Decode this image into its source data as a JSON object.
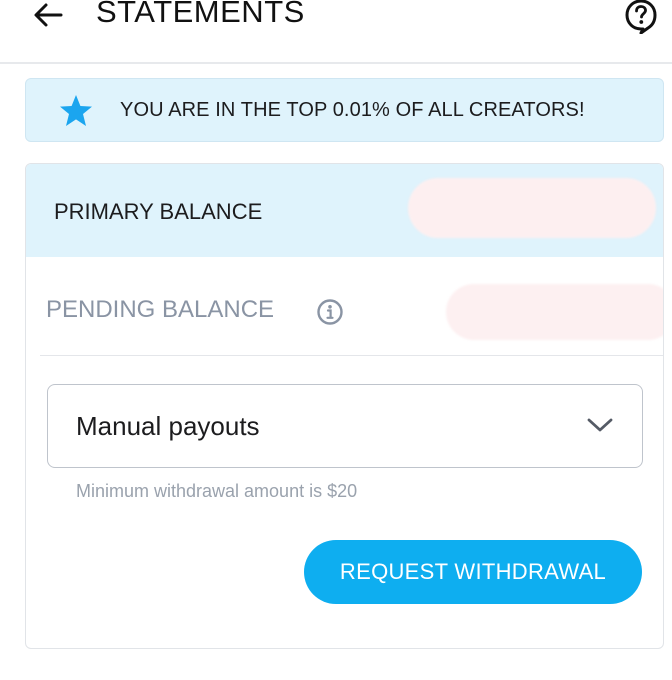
{
  "header": {
    "title": "STATEMENTS",
    "back_icon": "arrow-left-icon",
    "help_icon": "help-circle-icon"
  },
  "banner": {
    "text": "YOU ARE IN THE TOP 0.01% OF ALL CREATORS!",
    "icon": "star-icon"
  },
  "balances": {
    "primary_label": "PRIMARY BALANCE",
    "pending_label": "PENDING BALANCE",
    "pending_info_icon": "info-icon"
  },
  "payout": {
    "selected": "Manual payouts",
    "helper": "Minimum withdrawal amount is $20"
  },
  "actions": {
    "request_withdrawal": "REQUEST WITHDRAWAL"
  },
  "colors": {
    "accent": "#0eaef0",
    "banner_bg": "#dff3fc",
    "star": "#1ba5ef",
    "muted_text": "#8a94a4"
  }
}
